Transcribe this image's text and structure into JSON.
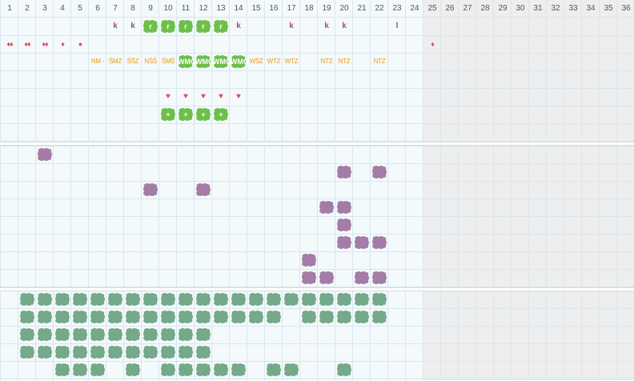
{
  "headers": [
    "1",
    "2",
    "3",
    "4",
    "5",
    "6",
    "7",
    "8",
    "9",
    "10",
    "11",
    "12",
    "13",
    "14",
    "15",
    "16",
    "17",
    "18",
    "19",
    "20",
    "21",
    "22",
    "23",
    "24",
    "25",
    "26",
    "27",
    "28",
    "29",
    "30",
    "31",
    "32",
    "33",
    "34",
    "35",
    "36"
  ],
  "active_columns": 24,
  "colors": {
    "active_bg": "#f4f9fc",
    "inactive_bg": "#eeeeee",
    "green": "#6cc04a",
    "purple": "#a57ca5",
    "sage": "#74a98a",
    "orange": "#e89a1a",
    "k": "#9c4f78",
    "heart": "#e04d6f"
  },
  "top_marks": [
    {
      "col": 7,
      "row": 1,
      "type": "k",
      "text": "k"
    },
    {
      "col": 8,
      "row": 1,
      "type": "k",
      "text": "k"
    },
    {
      "col": 14,
      "row": 1,
      "type": "k",
      "text": "k"
    },
    {
      "col": 17,
      "row": 1,
      "type": "k",
      "text": "k"
    },
    {
      "col": 19,
      "row": 1,
      "type": "k",
      "text": "k"
    },
    {
      "col": 20,
      "row": 1,
      "type": "k",
      "text": "k"
    },
    {
      "col": 23,
      "row": 1,
      "type": "k",
      "text": "l"
    },
    {
      "col": 1,
      "row": 2,
      "type": "drop",
      "text": "♦♦"
    },
    {
      "col": 2,
      "row": 2,
      "type": "drop",
      "text": "♦♦"
    },
    {
      "col": 3,
      "row": 2,
      "type": "drop",
      "text": "♦♦"
    },
    {
      "col": 4,
      "row": 2,
      "type": "drop",
      "text": "♦"
    },
    {
      "col": 5,
      "row": 2,
      "type": "drop",
      "text": "●"
    },
    {
      "col": 25,
      "row": 2,
      "type": "drop",
      "text": "♦"
    },
    {
      "col": 6,
      "row": 3,
      "type": "shift",
      "text": "NM -"
    },
    {
      "col": 7,
      "row": 3,
      "type": "shift",
      "text": "ŚMZ"
    },
    {
      "col": 8,
      "row": 3,
      "type": "shift",
      "text": "ŚŚZ"
    },
    {
      "col": 9,
      "row": 3,
      "type": "shift",
      "text": "NŚŚ"
    },
    {
      "col": 10,
      "row": 3,
      "type": "shift",
      "text": "ŚMŚ"
    },
    {
      "col": 15,
      "row": 3,
      "type": "shift",
      "text": "WŚZ"
    },
    {
      "col": 16,
      "row": 3,
      "type": "shift",
      "text": "WTZ"
    },
    {
      "col": 17,
      "row": 3,
      "type": "shift",
      "text": "WTZ"
    },
    {
      "col": 19,
      "row": 3,
      "type": "shift",
      "text": "NTZ"
    },
    {
      "col": 20,
      "row": 3,
      "type": "shift",
      "text": "NTZ"
    },
    {
      "col": 22,
      "row": 3,
      "type": "shift",
      "text": "NTZ"
    },
    {
      "col": 10,
      "row": 5,
      "type": "heart",
      "text": "♥"
    },
    {
      "col": 11,
      "row": 5,
      "type": "heart",
      "text": "♥"
    },
    {
      "col": 12,
      "row": 5,
      "type": "heart",
      "text": "♥"
    },
    {
      "col": 13,
      "row": 5,
      "type": "heart",
      "text": "♥"
    },
    {
      "col": 14,
      "row": 5,
      "type": "heart",
      "text": "♥"
    }
  ],
  "green_blobs": [
    {
      "col": 9,
      "row": 1,
      "label": "r"
    },
    {
      "col": 10,
      "row": 1,
      "label": "r"
    },
    {
      "col": 11,
      "row": 1,
      "label": "r"
    },
    {
      "col": 12,
      "row": 1,
      "label": "r"
    },
    {
      "col": 13,
      "row": 1,
      "label": "r"
    },
    {
      "col": 11,
      "row": 3,
      "label": "WMO"
    },
    {
      "col": 12,
      "row": 3,
      "label": "WMO"
    },
    {
      "col": 13,
      "row": 3,
      "label": "WMO"
    },
    {
      "col": 14,
      "row": 3,
      "label": "WMO"
    },
    {
      "col": 10,
      "row": 6,
      "label": "+"
    },
    {
      "col": 11,
      "row": 6,
      "label": "+"
    },
    {
      "col": 12,
      "row": 6,
      "label": "+"
    },
    {
      "col": 13,
      "row": 6,
      "label": "+"
    }
  ],
  "purple_blobs": [
    {
      "col": 3,
      "row": 1
    },
    {
      "col": 20,
      "row": 2
    },
    {
      "col": 22,
      "row": 2
    },
    {
      "col": 9,
      "row": 3
    },
    {
      "col": 12,
      "row": 3
    },
    {
      "col": 19,
      "row": 4
    },
    {
      "col": 20,
      "row": 4
    },
    {
      "col": 20,
      "row": 5
    },
    {
      "col": 20,
      "row": 6
    },
    {
      "col": 21,
      "row": 6
    },
    {
      "col": 22,
      "row": 6
    },
    {
      "col": 18,
      "row": 7
    },
    {
      "col": 18,
      "row": 8
    },
    {
      "col": 19,
      "row": 8
    },
    {
      "col": 21,
      "row": 8
    },
    {
      "col": 22,
      "row": 8
    }
  ],
  "sage_rows": [
    [
      2,
      3,
      4,
      5,
      6,
      7,
      8,
      9,
      10,
      11,
      12,
      13,
      14,
      15,
      16,
      17,
      18,
      19,
      20,
      21,
      22
    ],
    [
      2,
      3,
      4,
      5,
      6,
      7,
      8,
      9,
      10,
      11,
      12,
      13,
      14,
      15,
      16,
      18,
      19,
      20,
      21,
      22
    ],
    [
      2,
      3,
      4,
      5,
      6,
      7,
      8,
      9,
      10,
      11,
      12
    ],
    [
      2,
      3,
      4,
      5,
      6,
      7,
      8,
      9,
      10,
      11,
      12
    ],
    [
      4,
      5,
      6,
      8,
      10,
      11,
      12,
      13,
      14,
      16,
      17,
      20
    ]
  ]
}
